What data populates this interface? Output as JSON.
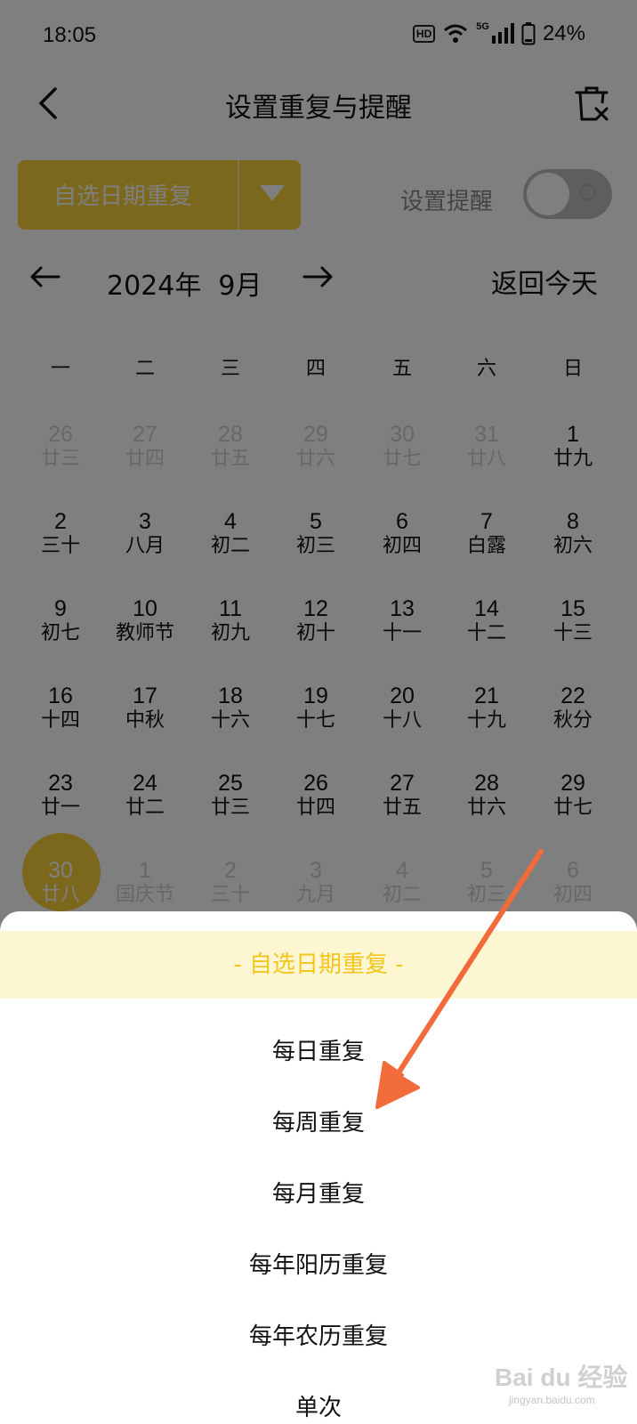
{
  "status_bar": {
    "time": "18:05",
    "hd": "HD",
    "network": "5G",
    "battery": "24%"
  },
  "header": {
    "title": "设置重复与提醒",
    "back_icon": "back-chevron-icon",
    "delete_icon": "trash-icon"
  },
  "mode_selector": {
    "label": "自选日期重复",
    "dropdown_icon": "caret-down-icon",
    "color": "#f7d13a"
  },
  "reminder": {
    "label": "设置提醒",
    "enabled": false
  },
  "month_nav": {
    "month": "2024年  9月",
    "today": "返回今天"
  },
  "weekdays": [
    "一",
    "二",
    "三",
    "四",
    "五",
    "六",
    "日"
  ],
  "calendar": [
    [
      [
        "26",
        "廿三"
      ],
      [
        "27",
        "廿四"
      ],
      [
        "28",
        "廿五"
      ],
      [
        "29",
        "廿六"
      ],
      [
        "30",
        "廿七"
      ],
      [
        "31",
        "廿八"
      ],
      [
        "1",
        "廿九"
      ]
    ],
    [
      [
        "2",
        "三十"
      ],
      [
        "3",
        "八月"
      ],
      [
        "4",
        "初二"
      ],
      [
        "5",
        "初三"
      ],
      [
        "6",
        "初四"
      ],
      [
        "7",
        "白露"
      ],
      [
        "8",
        "初六"
      ]
    ],
    [
      [
        "9",
        "初七"
      ],
      [
        "10",
        "教师节"
      ],
      [
        "11",
        "初九"
      ],
      [
        "12",
        "初十"
      ],
      [
        "13",
        "十一"
      ],
      [
        "14",
        "十二"
      ],
      [
        "15",
        "十三"
      ]
    ],
    [
      [
        "16",
        "十四"
      ],
      [
        "17",
        "中秋"
      ],
      [
        "18",
        "十六"
      ],
      [
        "19",
        "十七"
      ],
      [
        "20",
        "十八"
      ],
      [
        "21",
        "十九"
      ],
      [
        "22",
        "秋分"
      ]
    ],
    [
      [
        "23",
        "廿一"
      ],
      [
        "24",
        "廿二"
      ],
      [
        "25",
        "廿三"
      ],
      [
        "26",
        "廿四"
      ],
      [
        "27",
        "廿五"
      ],
      [
        "28",
        "廿六"
      ],
      [
        "29",
        "廿七"
      ]
    ],
    [
      [
        "30",
        "廿八"
      ],
      [
        "1",
        "国庆节"
      ],
      [
        "2",
        "三十"
      ],
      [
        "3",
        "九月"
      ],
      [
        "4",
        "初二"
      ],
      [
        "5",
        "初三"
      ],
      [
        "6",
        "初四"
      ]
    ]
  ],
  "selected_date": "30",
  "sheet": {
    "options": [
      "- 自选日期重复 -",
      "每日重复",
      "每周重复",
      "每月重复",
      "每年阳历重复",
      "每年农历重复",
      "单次"
    ],
    "active_color": "#f2c51f",
    "active_bg": "#fdf6d2"
  },
  "annotation": {
    "arrow_color": "#f26b3a"
  },
  "watermark": {
    "text": "Bai du 经验",
    "sub": "jingyan.baidu.com"
  }
}
